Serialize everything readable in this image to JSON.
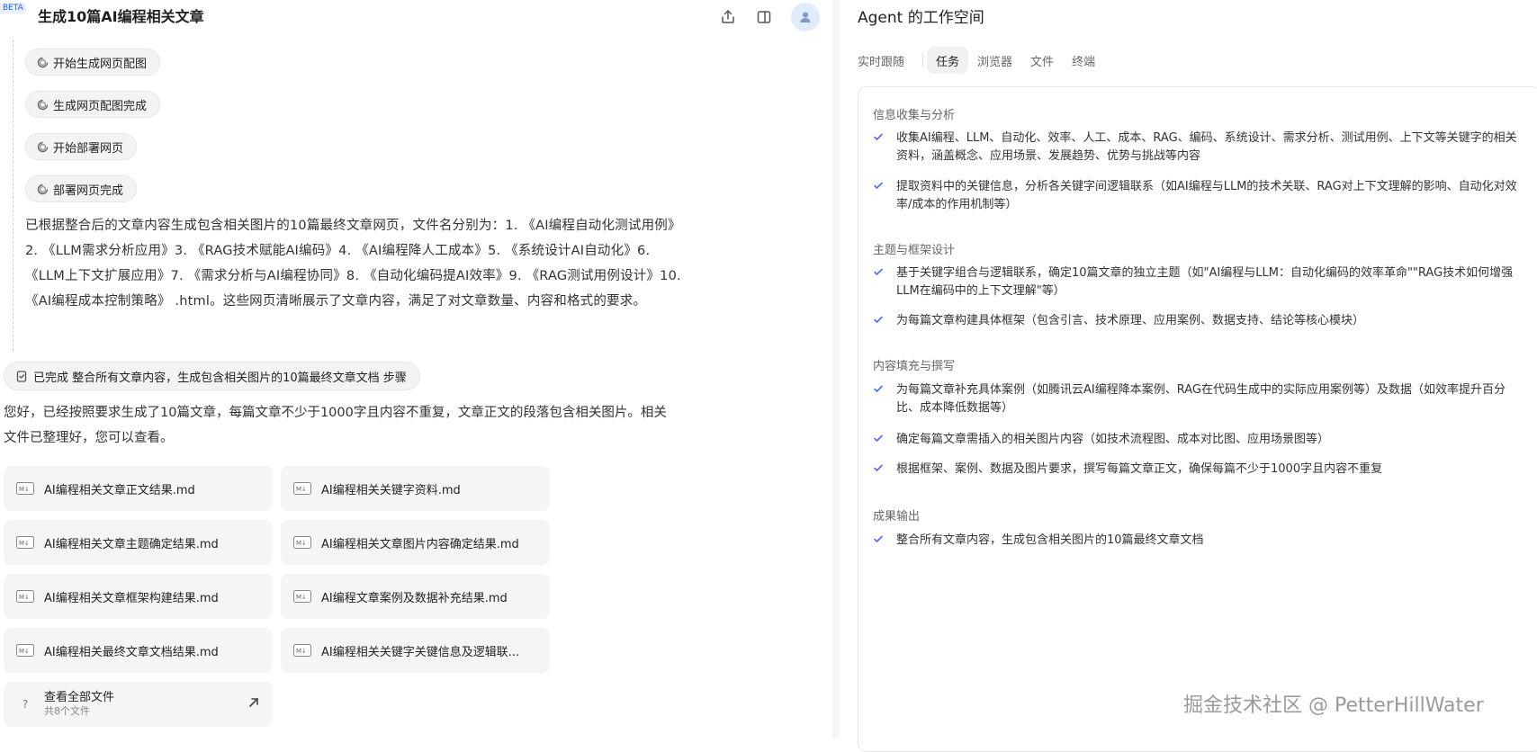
{
  "header": {
    "beta": "BETA",
    "title": "生成10篇AI编程相关文章"
  },
  "steps": [
    "开始生成网页配图",
    "生成网页配图完成",
    "开始部署网页",
    "部署网页完成"
  ],
  "result_paragraph": "已根据整合后的文章内容生成包含相关图片的10篇最终文章网页，文件名分别为：1. 《AI编程自动化测试用例》2. 《LLM需求分析应用》3. 《RAG技术赋能AI编码》4. 《AI编程降人工成本》5. 《系统设计AI自动化》6. 《LLM上下文扩展应用》7. 《需求分析与AI编程协同》8. 《自动化编码提AI效率》9. 《RAG测试用例设计》10. 《AI编程成本控制策略》 .html。这些网页清晰展示了文章内容，满足了对文章数量、内容和格式的要求。",
  "completed_step": "已完成 整合所有文章内容，生成包含相关图片的10篇最终文章文档 步骤",
  "reply": "您好，已经按照要求生成了10篇文章，每篇文章不少于1000字且内容不重复，文章正文的段落包含相关图片。相关文件已整理好，您可以查看。",
  "files": [
    "AI编程相关文章正文结果.md",
    "AI编程相关关键字资料.md",
    "AI编程相关文章主题确定结果.md",
    "AI编程相关文章图片内容确定结果.md",
    "AI编程相关文章框架构建结果.md",
    "AI编程文章案例及数据补充结果.md",
    "AI编程相关最终文章文档结果.md",
    "AI编程相关关键字关键信息及逻辑联..."
  ],
  "view_all": {
    "title": "查看全部文件",
    "count": "共8个文件"
  },
  "workspace": {
    "title": "Agent 的工作空间",
    "tabs": [
      "实时跟随",
      "任务",
      "浏览器",
      "文件",
      "终端"
    ],
    "active_tab": "任务"
  },
  "sections": [
    {
      "title": "信息收集与分析",
      "tasks": [
        "收集AI编程、LLM、自动化、效率、人工、成本、RAG、编码、系统设计、需求分析、测试用例、上下文等关键字的相关资料，涵盖概念、应用场景、发展趋势、优势与挑战等内容",
        "提取资料中的关键信息，分析各关键字间逻辑联系（如AI编程与LLM的技术关联、RAG对上下文理解的影响、自动化对效率/成本的作用机制等）"
      ]
    },
    {
      "title": "主题与框架设计",
      "tasks": [
        "基于关键字组合与逻辑联系，确定10篇文章的独立主题（如\"AI编程与LLM：自动化编码的效率革命\"\"RAG技术如何增强LLM在编码中的上下文理解\"等）",
        "为每篇文章构建具体框架（包含引言、技术原理、应用案例、数据支持、结论等核心模块）"
      ]
    },
    {
      "title": "内容填充与撰写",
      "tasks": [
        "为每篇文章补充具体案例（如腾讯云AI编程降本案例、RAG在代码生成中的实际应用案例等）及数据（如效率提升百分比、成本降低数据等）",
        "确定每篇文章需插入的相关图片内容（如技术流程图、成本对比图、应用场景图等）",
        "根据框架、案例、数据及图片要求，撰写每篇文章正文，确保每篇不少于1000字且内容不重复"
      ]
    },
    {
      "title": "成果输出",
      "tasks": [
        "整合所有文章内容，生成包含相关图片的10篇最终文章文档"
      ]
    }
  ],
  "watermark": "掘金技术社区 @ PetterHillWater",
  "colors": {
    "check": "#4a6cf7",
    "avatar_bg": "#e1ecfa"
  }
}
